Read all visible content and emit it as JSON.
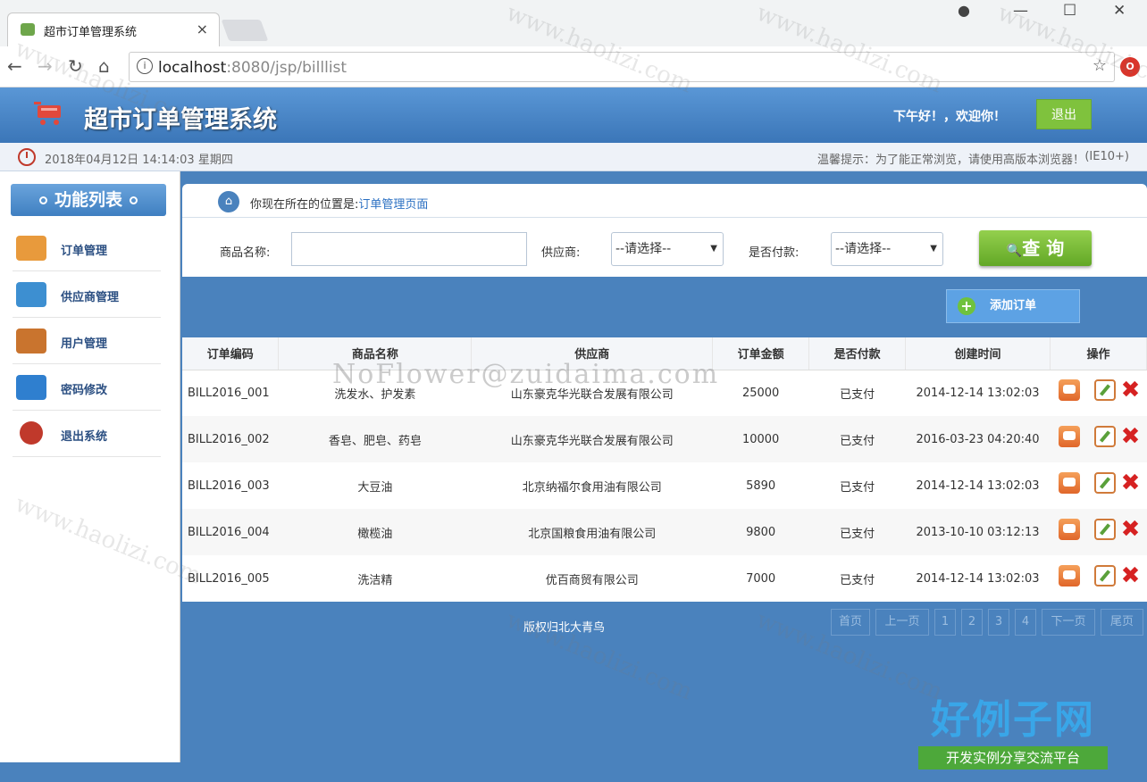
{
  "browser": {
    "tab_title": "超市订单管理系统",
    "tab_close": "×",
    "address_host": "localhost",
    "address_path": ":8080/jsp/billlist",
    "info_glyph": "i",
    "star_glyph": "☆",
    "ext_glyph": "O",
    "minimize": "—",
    "maximize": "☐",
    "close": "✕",
    "account_glyph": "●"
  },
  "header": {
    "app_title": "超市订单管理系统",
    "greeting": "下午好！，欢迎你！",
    "logout": "退出"
  },
  "info": {
    "datetime": "2018年04月12日 14:14:03 星期四",
    "tip": "温馨提示：为了能正常浏览，请使用高版本浏览器！",
    "tip_suffix": "(IE10+)"
  },
  "sidebar": {
    "title": "功能列表",
    "items": [
      {
        "label": "订单管理",
        "icon": "order-icon",
        "color": "#e89a3c"
      },
      {
        "label": "供应商管理",
        "icon": "supplier-icon",
        "color": "#3d8fd1"
      },
      {
        "label": "用户管理",
        "icon": "users-icon",
        "color": "#c9742e"
      },
      {
        "label": "密码修改",
        "icon": "password-icon",
        "color": "#2f7fcf"
      },
      {
        "label": "退出系统",
        "icon": "exit-icon",
        "color": "#c0392b"
      }
    ]
  },
  "breadcrumb": {
    "prefix": "你现在所在的位置是:",
    "current": "订单管理页面",
    "home_glyph": "⌂"
  },
  "search": {
    "product_label": "商品名称:",
    "product_value": "",
    "supplier_label": "供应商:",
    "supplier_selected": "--请选择--",
    "paid_label": "是否付款:",
    "paid_selected": "--请选择--",
    "caret": "▼",
    "query_button": "查 询",
    "query_glyph": "🔍"
  },
  "add_button": "添加订单",
  "add_glyph": "+",
  "table": {
    "headers": [
      "订单编码",
      "商品名称",
      "供应商",
      "订单金额",
      "是否付款",
      "创建时间",
      "操作"
    ],
    "rows": [
      [
        "BILL2016_001",
        "洗发水、护发素",
        "山东豪克华光联合发展有限公司",
        "25000",
        "已支付",
        "2014-12-14 13:02:03"
      ],
      [
        "BILL2016_002",
        "香皂、肥皂、药皂",
        "山东豪克华光联合发展有限公司",
        "10000",
        "已支付",
        "2016-03-23 04:20:40"
      ],
      [
        "BILL2016_003",
        "大豆油",
        "北京纳福尔食用油有限公司",
        "5890",
        "已支付",
        "2014-12-14 13:02:03"
      ],
      [
        "BILL2016_004",
        "橄榄油",
        "北京国粮食用油有限公司",
        "9800",
        "已支付",
        "2013-10-10 03:12:13"
      ],
      [
        "BILL2016_005",
        "洗洁精",
        "优百商贸有限公司",
        "7000",
        "已支付",
        "2014-12-14 13:02:03"
      ]
    ],
    "delete_glyph": "✖"
  },
  "footer": "版权归北大青鸟",
  "pager": [
    "首页",
    "上一页",
    "1",
    "2",
    "3",
    "4",
    "下一页",
    "尾页"
  ],
  "watermarks": {
    "site": "www.haolizi.com",
    "center": "NoFlower@zuidaima.com",
    "logo_big": "好例子网",
    "logo_small": "开发实例分享交流平台"
  },
  "colors": {
    "header_blue": "#3b76b8",
    "accent_green": "#7fc23d",
    "delete_red": "#d62222"
  }
}
